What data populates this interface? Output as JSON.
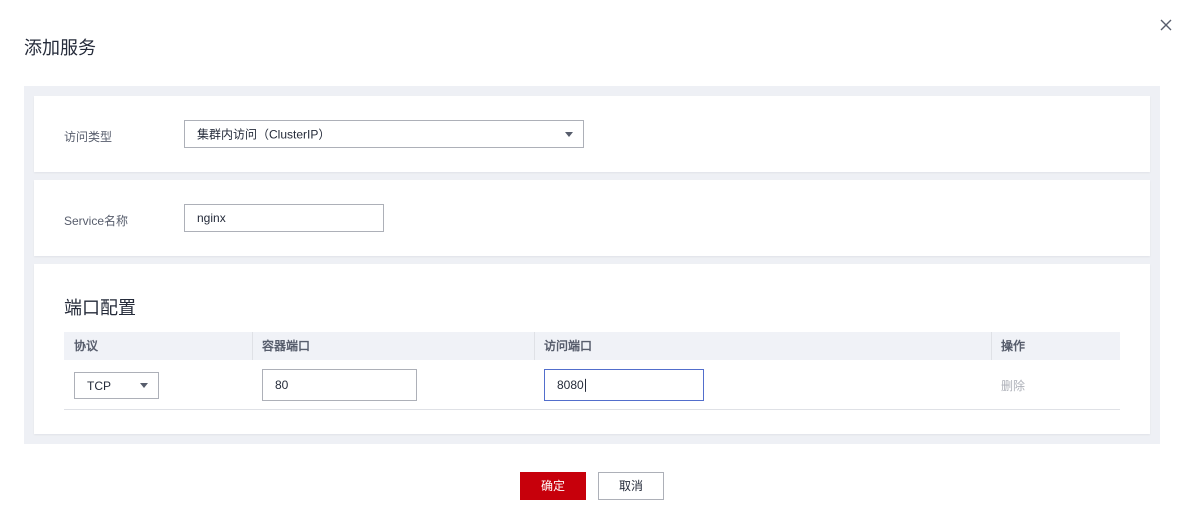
{
  "dialog": {
    "title": "添加服务",
    "close_icon": "close-icon"
  },
  "access_type": {
    "label": "访问类型",
    "selected": "集群内访问（ClusterIP）"
  },
  "service_name": {
    "label": "Service名称",
    "value": "nginx"
  },
  "port_config": {
    "title": "端口配置",
    "columns": [
      "协议",
      "容器端口",
      "访问端口",
      "操作"
    ],
    "rows": [
      {
        "protocol": "TCP",
        "container_port": "80",
        "access_port": "8080",
        "action": "删除"
      }
    ]
  },
  "footer": {
    "ok_label": "确定",
    "cancel_label": "取消"
  },
  "colors": {
    "primary": "#c7000b",
    "focus_border": "#526ecc",
    "panel_bg": "#eef0f5"
  }
}
